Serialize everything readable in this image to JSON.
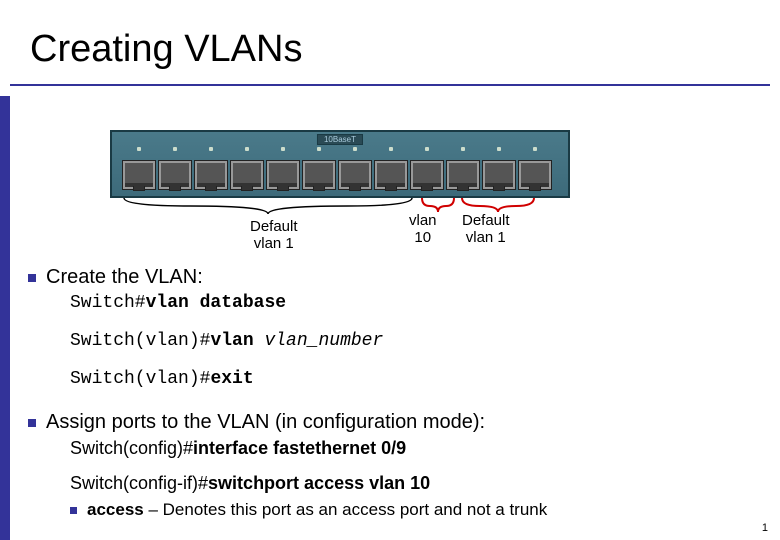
{
  "title": "Creating VLANs",
  "switch": {
    "top_label": "10BaseT",
    "port_count": 12,
    "brackets": [
      {
        "label_line1": "Default",
        "label_line2": "vlan 1",
        "color": "#000000"
      },
      {
        "label_line1": "vlan",
        "label_line2": "10",
        "color": "#d00000"
      },
      {
        "label_line1": "Default",
        "label_line2": "vlan 1",
        "color": "#d00000"
      }
    ]
  },
  "section1": {
    "heading": "Create the VLAN:",
    "cmd1_prompt": "Switch#",
    "cmd1_bold": "vlan database",
    "cmd2_prompt": "Switch(vlan)#",
    "cmd2_bold": "vlan ",
    "cmd2_italic": "vlan_number",
    "cmd3_prompt": "Switch(vlan)#",
    "cmd3_bold": "exit"
  },
  "section2": {
    "heading": "Assign ports to the VLAN (in configuration mode):",
    "cmd1_prompt": "Switch(config)#",
    "cmd1_bold": "interface fastethernet 0/9",
    "cmd2_prompt": "Switch(config-if)#",
    "cmd2_bold": "switchport access vlan 10",
    "note_bold": "access",
    "note_rest": " – Denotes this port as an access port and not a trunk"
  },
  "page_number": "1"
}
